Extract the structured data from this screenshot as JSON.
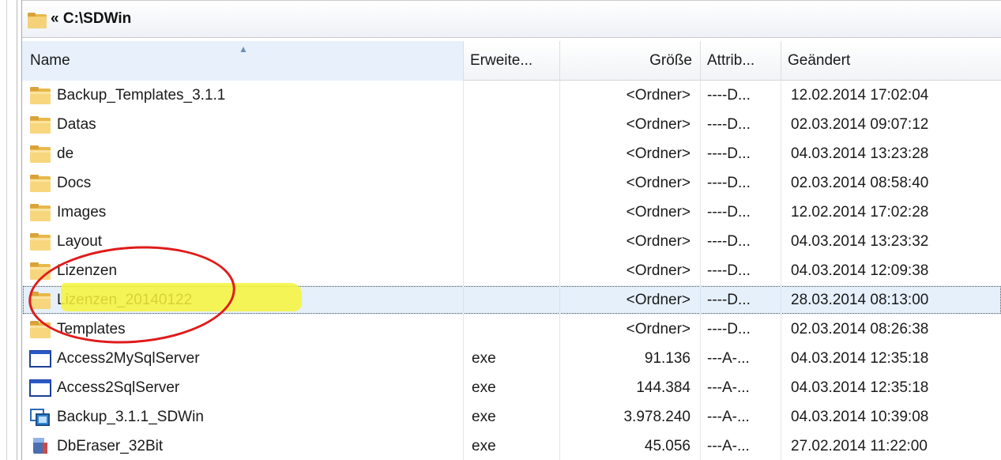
{
  "path_bar": {
    "path": "« C:\\SDWin"
  },
  "columns": {
    "name": "Name",
    "ext": "Erweite...",
    "size": "Größe",
    "attr": "Attrib...",
    "modified": "Geändert"
  },
  "rows": [
    {
      "name": "Backup_Templates_3.1.1",
      "ext": "",
      "size": "<Ordner>",
      "attr": "----D...",
      "modified": "12.02.2014 17:02:04",
      "icon": "folder-icon"
    },
    {
      "name": "Datas",
      "ext": "",
      "size": "<Ordner>",
      "attr": "----D...",
      "modified": "02.03.2014 09:07:12",
      "icon": "folder-icon"
    },
    {
      "name": "de",
      "ext": "",
      "size": "<Ordner>",
      "attr": "----D...",
      "modified": "04.03.2014 13:23:28",
      "icon": "folder-icon"
    },
    {
      "name": "Docs",
      "ext": "",
      "size": "<Ordner>",
      "attr": "----D...",
      "modified": "02.03.2014 08:58:40",
      "icon": "folder-icon"
    },
    {
      "name": "Images",
      "ext": "",
      "size": "<Ordner>",
      "attr": "----D...",
      "modified": "12.02.2014 17:02:28",
      "icon": "folder-icon"
    },
    {
      "name": "Layout",
      "ext": "",
      "size": "<Ordner>",
      "attr": "----D...",
      "modified": "04.03.2014 13:23:32",
      "icon": "folder-icon"
    },
    {
      "name": "Lizenzen",
      "ext": "",
      "size": "<Ordner>",
      "attr": "----D...",
      "modified": "04.03.2014 12:09:38",
      "icon": "folder-icon"
    },
    {
      "name": "Lizenzen_20140122",
      "ext": "",
      "size": "<Ordner>",
      "attr": "----D...",
      "modified": "28.03.2014 08:13:00",
      "icon": "folder-icon",
      "selected": true
    },
    {
      "name": "Templates",
      "ext": "",
      "size": "<Ordner>",
      "attr": "----D...",
      "modified": "02.03.2014 08:26:38",
      "icon": "folder-icon"
    },
    {
      "name": "Access2MySqlServer",
      "ext": "exe",
      "size": "91.136",
      "attr": "---A-...",
      "modified": "04.03.2014 12:35:18",
      "icon": "window-icon"
    },
    {
      "name": "Access2SqlServer",
      "ext": "exe",
      "size": "144.384",
      "attr": "---A-...",
      "modified": "04.03.2014 12:35:18",
      "icon": "window-icon"
    },
    {
      "name": "Backup_3.1.1_SDWin",
      "ext": "exe",
      "size": "3.978.240",
      "attr": "---A-...",
      "modified": "04.03.2014 10:39:08",
      "icon": "app-icon"
    },
    {
      "name": "DbEraser_32Bit",
      "ext": "exe",
      "size": "45.056",
      "attr": "---A-...",
      "modified": "27.02.2014 11:22:00",
      "icon": "eraser-icon"
    }
  ],
  "colors": {
    "selection": "#e5f0fb",
    "marker_highlight": "#f7f53a",
    "annotation_circle": "#e01b1b",
    "folder": "#e8b84a"
  }
}
